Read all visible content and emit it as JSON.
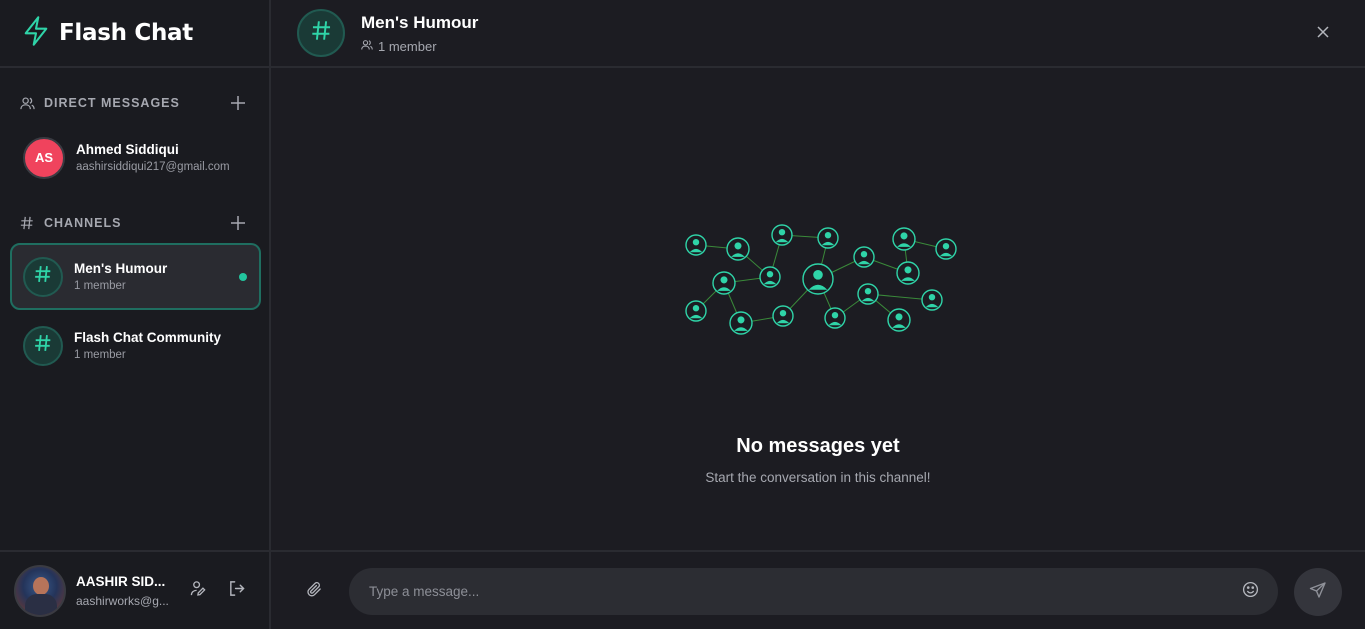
{
  "app": {
    "name": "Flash Chat",
    "accent": "#2fd4a8"
  },
  "direct_messages": {
    "heading": "DIRECT MESSAGES",
    "items": [
      {
        "initials": "AS",
        "name": "Ahmed Siddiqui",
        "email": "aashirsiddiqui217@gmail.com",
        "avatar_color": "#f0435d"
      }
    ]
  },
  "channels": {
    "heading": "CHANNELS",
    "items": [
      {
        "name": "Men's Humour",
        "members": "1 member",
        "active": true,
        "unread": true
      },
      {
        "name": "Flash Chat Community",
        "members": "1 member",
        "active": false,
        "unread": false
      }
    ]
  },
  "current_user": {
    "name": "AASHIR SID...",
    "email": "aashirworks@g..."
  },
  "header": {
    "title": "Men's Humour",
    "members": "1 member"
  },
  "empty_state": {
    "title": "No messages yet",
    "subtitle": "Start the conversation in this channel!"
  },
  "composer": {
    "placeholder": "Type a message..."
  },
  "icons": {
    "brand": "lightning-icon",
    "dm": "users-icon",
    "channels": "hash-icon",
    "add": "plus-icon",
    "edit_profile": "user-edit-icon",
    "logout": "logout-icon",
    "close": "close-icon",
    "attach": "paperclip-icon",
    "emoji": "smile-icon",
    "send": "send-icon"
  }
}
